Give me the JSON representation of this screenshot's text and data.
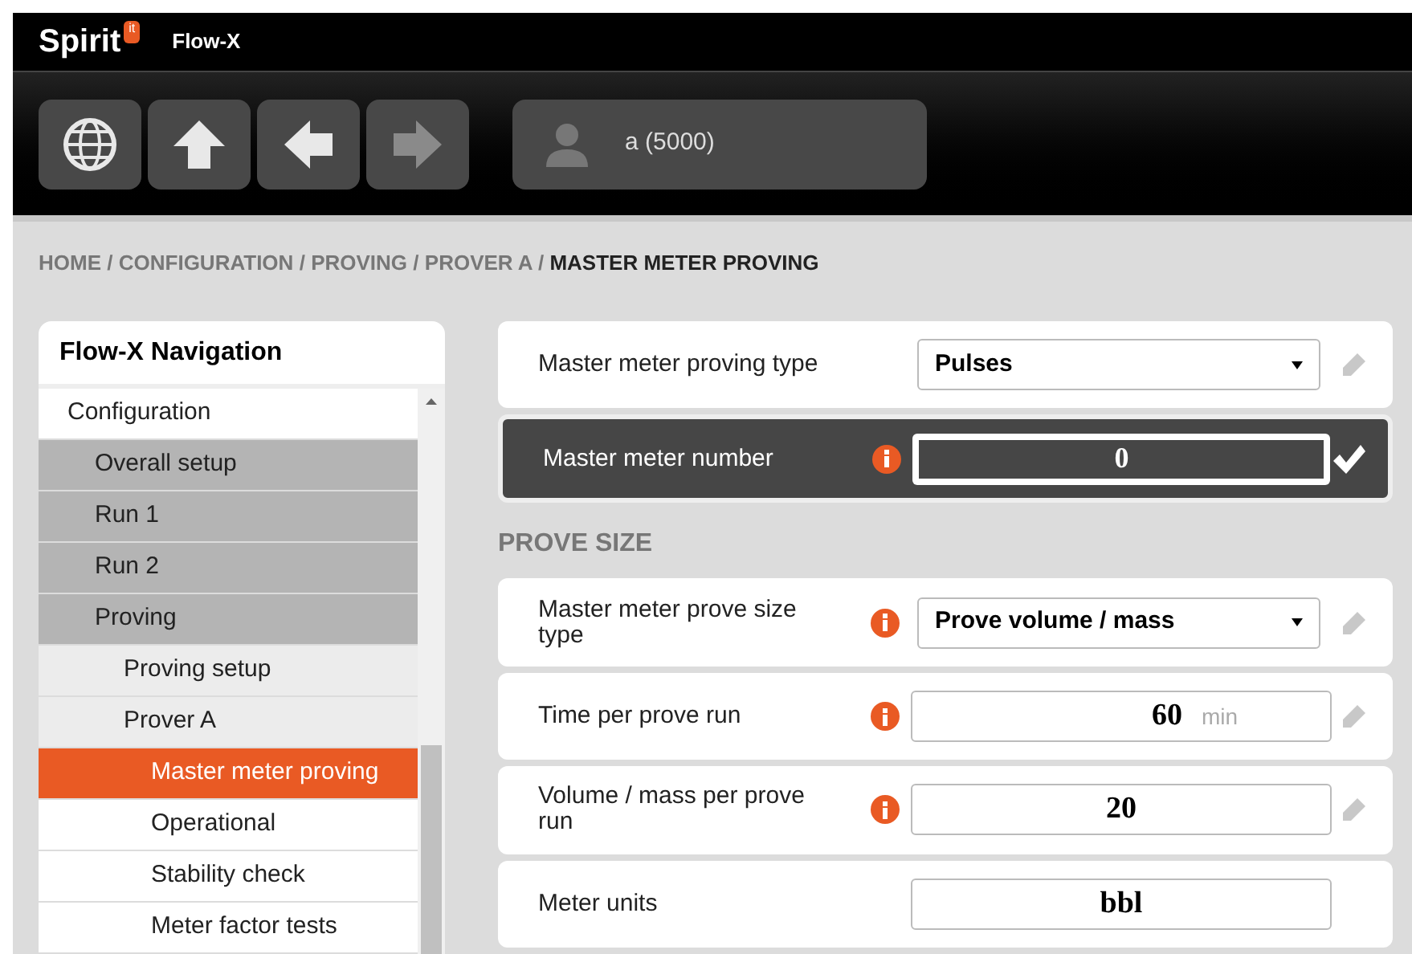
{
  "header": {
    "logo": "Spirit",
    "logo_badge": "it",
    "app": "Flow-X"
  },
  "toolbar": {
    "buttons": [
      {
        "kind": "globe",
        "disabled": false
      },
      {
        "kind": "up",
        "disabled": false
      },
      {
        "kind": "back",
        "disabled": false
      },
      {
        "kind": "forward",
        "disabled": true
      }
    ],
    "user": "a (5000)"
  },
  "breadcrumb": {
    "separator": "/",
    "items": [
      "HOME",
      "CONFIGURATION",
      "PROVING",
      "PROVER A"
    ],
    "current": "MASTER METER PROVING"
  },
  "navigation": {
    "title": "Flow-X Navigation",
    "items": [
      {
        "label": "Configuration",
        "selected": false,
        "children": [
          {
            "label": "Overall setup",
            "selected": false
          },
          {
            "label": "Run 1",
            "selected": false
          },
          {
            "label": "Run 2",
            "selected": false
          },
          {
            "label": "Proving",
            "selected": false,
            "children": [
              {
                "label": "Proving setup",
                "selected": false
              },
              {
                "label": "Prover A",
                "selected": false,
                "children": [
                  {
                    "label": "Master meter proving",
                    "selected": true
                  },
                  {
                    "label": "Operational",
                    "selected": false
                  },
                  {
                    "label": "Stability check",
                    "selected": false
                  },
                  {
                    "label": "Meter factor tests",
                    "selected": false
                  }
                ]
              }
            ]
          }
        ]
      }
    ]
  },
  "settings": [
    {
      "kind": "select",
      "label": "Master meter proving type",
      "value": "Pulses",
      "info": false,
      "editing": false,
      "editable": true
    },
    {
      "kind": "input",
      "label": "Master meter number",
      "value": "0",
      "info": true,
      "editing": true
    },
    {
      "kind": "heading",
      "label": "PROVE SIZE"
    },
    {
      "kind": "select",
      "label": "Master meter prove size type",
      "value": "Prove volume / mass",
      "info": true,
      "editing": false,
      "editable": true
    },
    {
      "kind": "input",
      "label": "Time per prove run",
      "value": "60",
      "unit": "min",
      "info": true,
      "editing": false,
      "editable": true
    },
    {
      "kind": "input",
      "label": "Volume / mass per prove run",
      "value": "20",
      "info": true,
      "editing": false,
      "editable": true
    },
    {
      "kind": "input",
      "label": "Meter units",
      "value": "bbl",
      "info": false,
      "editing": false,
      "editable": false
    }
  ]
}
